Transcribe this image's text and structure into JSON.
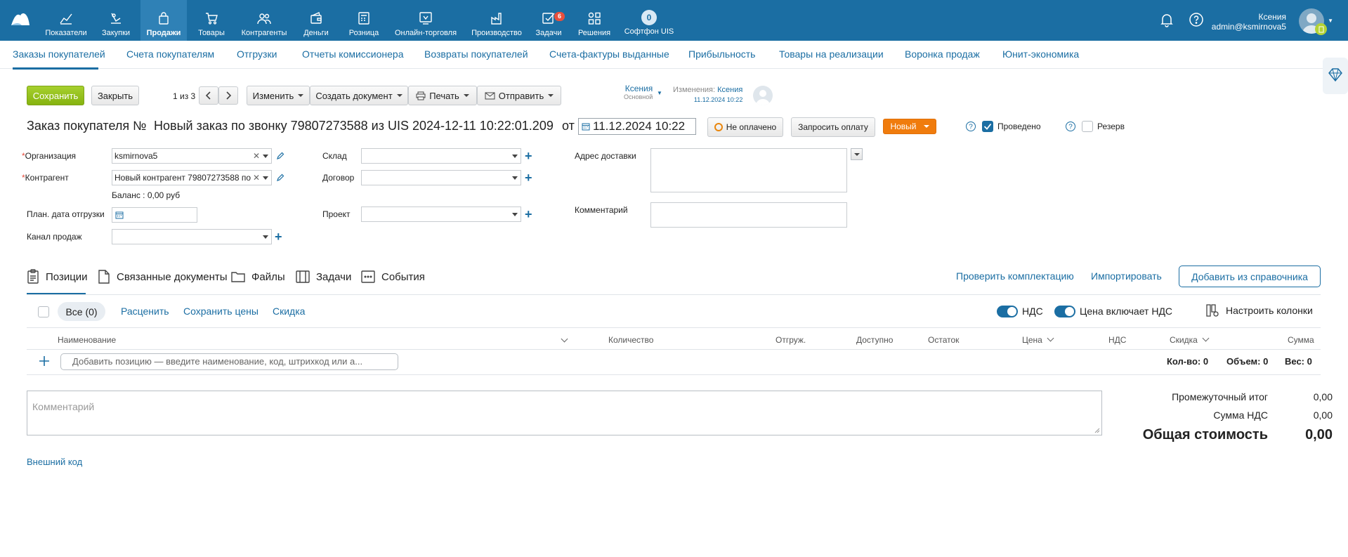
{
  "topnav": {
    "items": [
      {
        "label": "Показатели",
        "icon": "chart-line-icon"
      },
      {
        "label": "Закупки",
        "icon": "basket-hand-icon"
      },
      {
        "label": "Продажи",
        "icon": "bag-icon"
      },
      {
        "label": "Товары",
        "icon": "cart-icon"
      },
      {
        "label": "Контрагенты",
        "icon": "users-icon"
      },
      {
        "label": "Деньги",
        "icon": "wallet-icon"
      },
      {
        "label": "Розница",
        "icon": "cash-register-icon"
      },
      {
        "label": "Онлайн-торговля",
        "icon": "online-store-icon"
      },
      {
        "label": "Производство",
        "icon": "factory-icon"
      },
      {
        "label": "Задачи",
        "icon": "tasks-icon",
        "badge": "6"
      },
      {
        "label": "Решения",
        "icon": "apps-icon"
      },
      {
        "label": "Софтфон UIS",
        "icon": "softphone-icon",
        "circle_text": "0"
      }
    ],
    "active": "Продажи",
    "user": {
      "name": "Ксения",
      "login": "admin@ksmirnova5"
    }
  },
  "subnav": {
    "items": [
      "Заказы покупателей",
      "Счета покупателям",
      "Отгрузки",
      "Отчеты комиссионера",
      "Возвраты покупателей",
      "Счета-фактуры выданные",
      "Прибыльность",
      "Товары на реализации",
      "Воронка продаж",
      "Юнит-экономика"
    ],
    "active": "Заказы покупателей"
  },
  "toolbar": {
    "save": "Сохранить",
    "close": "Закрыть",
    "pager": "1 из 3",
    "change": "Изменить",
    "create_doc": "Создать документ",
    "print": "Печать",
    "send": "Отправить",
    "owner_name": "Ксения",
    "owner_role": "Основной",
    "changes_label": "Изменения:",
    "changes_user": "Ксения",
    "changes_date": "11.12.2024 10:22"
  },
  "doc": {
    "title_prefix": "Заказ покупателя №",
    "title_name": "Новый заказ по звонку 79807273588 из UIS 2024-12-11 10:22:01.209",
    "from": "от",
    "date": "11.12.2024 10:22",
    "payment_status": "Не оплачено",
    "request_payment": "Запросить оплату",
    "status": "Новый",
    "posted": "Проведено",
    "reserve": "Резерв"
  },
  "form": {
    "org_label": "Организация",
    "org_value": "ksmirnova5",
    "contractor_label": "Контрагент",
    "contractor_value": "Новый контрагент 79807273588 по",
    "balance": "Баланс : 0,00 руб",
    "ship_date_label": "План. дата отгрузки",
    "channel_label": "Канал продаж",
    "warehouse_label": "Склад",
    "contract_label": "Договор",
    "project_label": "Проект",
    "address_label": "Адрес доставки",
    "comment_label": "Комментарий"
  },
  "tabs": {
    "items": [
      "Позиции",
      "Связанные документы",
      "Файлы",
      "Задачи",
      "События"
    ],
    "check_kit": "Проверить комплектацию",
    "import": "Импортировать",
    "add_from_catalog": "Добавить из справочника"
  },
  "positions": {
    "all": "Все (0)",
    "reprice": "Расценить",
    "save_prices": "Сохранить цены",
    "discount": "Скидка",
    "vat": "НДС",
    "price_incl_vat": "Цена включает НДС",
    "columns_setup": "Настроить колонки",
    "columns": [
      "Наименование",
      "Количество",
      "Отгруж.",
      "Доступно",
      "Остаток",
      "Цена",
      "НДС",
      "Скидка",
      "Сумма"
    ],
    "add_placeholder": "Добавить позицию — введите наименование, код, штрихкод или а...",
    "qty": "Кол-во: 0",
    "volume": "Объем: 0",
    "weight": "Вес: 0"
  },
  "bottom": {
    "comment_placeholder": "Комментарий",
    "external_code": "Внешний код",
    "subtotal_label": "Промежуточный итог",
    "subtotal": "0,00",
    "vat_sum_label": "Сумма НДС",
    "vat_sum": "0,00",
    "total_label": "Общая стоимость",
    "total": "0,00"
  }
}
